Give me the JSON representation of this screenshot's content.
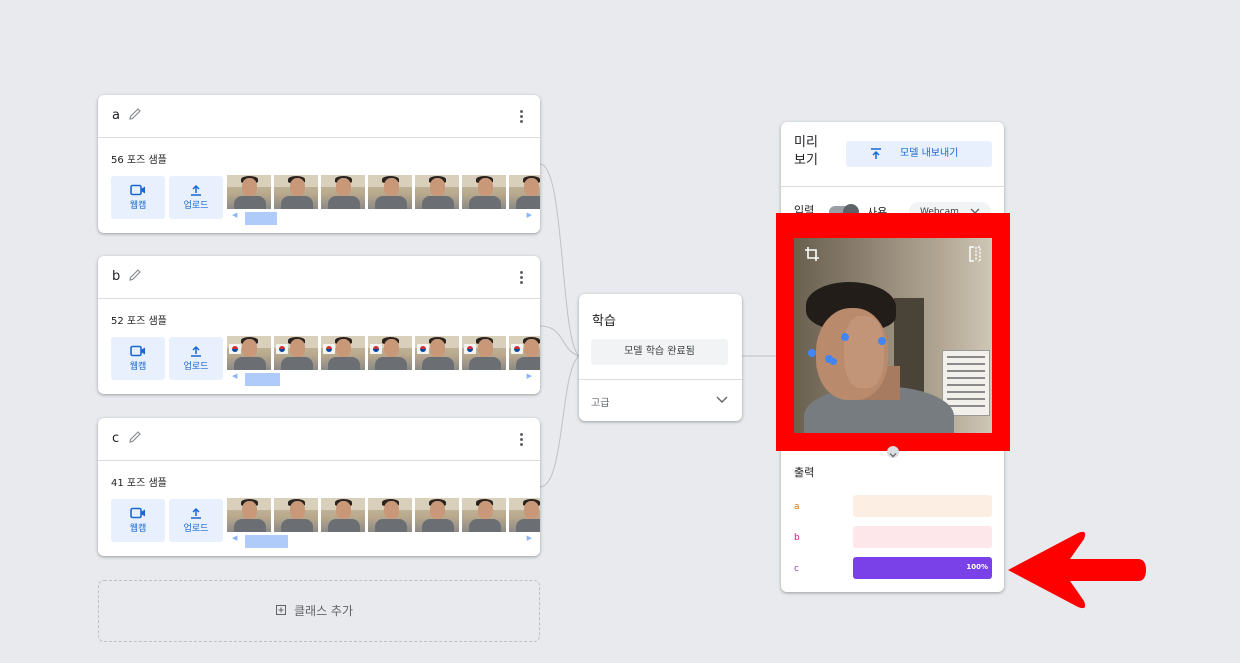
{
  "classes": [
    {
      "name": "a",
      "count": "56 포즈 샘플",
      "webcam": "웹캠",
      "upload": "업로드"
    },
    {
      "name": "b",
      "count": "52 포즈 샘플",
      "webcam": "웹캠",
      "upload": "업로드"
    },
    {
      "name": "c",
      "count": "41 포즈 샘플",
      "webcam": "웹캠",
      "upload": "업로드"
    }
  ],
  "add_class": "클래스 추가",
  "training": {
    "title": "학습",
    "button": "모델 학습 완료됨",
    "advanced": "고급"
  },
  "preview": {
    "title": "미리 보기",
    "export": "모델 내보내기",
    "input_label": "입력",
    "on_label": "사용",
    "source": "Webcam",
    "output_label": "출력",
    "outputs": [
      {
        "name": "a",
        "value": 0,
        "color": "#e8710a",
        "bg": "#fdeee3",
        "label": ""
      },
      {
        "name": "b",
        "value": 0,
        "color": "#d01884",
        "bg": "#fde7ea",
        "label": ""
      },
      {
        "name": "c",
        "value": 1,
        "color": "#7b41e8",
        "bg": "#7b41e8",
        "label": "100%"
      }
    ]
  },
  "colors": {
    "accent": "#1967d2",
    "highlight": "#ff0000"
  }
}
